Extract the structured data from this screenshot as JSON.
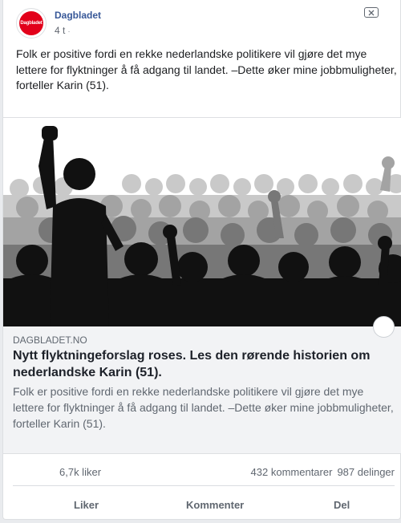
{
  "post": {
    "page_name": "Dagbladet",
    "logo_text": "Dagbladet",
    "time": "4 t",
    "separator": "·",
    "text": "Folk er positive fordi en rekke nederlandske politikere vil gjøre det mye lettere for flyktninger å få adgang til landet. –Dette øker mine jobbmuligheter, forteller Karin (51)."
  },
  "link": {
    "domain": "DAGBLADET.NO",
    "title": "Nytt flyktningeforslag roses. Les den rørende historien om nederlandske Karin (51).",
    "description": "Folk er positive fordi en rekke nederlandske politikere vil gjøre det mye lettere for flyktninger å få adgang til landet. –Dette øker mine jobbmuligheter, forteller Karin (51)."
  },
  "stats": {
    "likes": "6,7k liker",
    "comments": "432 kommentarer",
    "shares": "987 delinger"
  },
  "actions": {
    "like": "Liker",
    "comment": "Kommenter",
    "share": "Del"
  },
  "icons": {
    "hide_post": "close-box-icon"
  },
  "colors": {
    "brand_red": "#e2001a",
    "link_blue": "#385898",
    "text_gray": "#606770"
  }
}
